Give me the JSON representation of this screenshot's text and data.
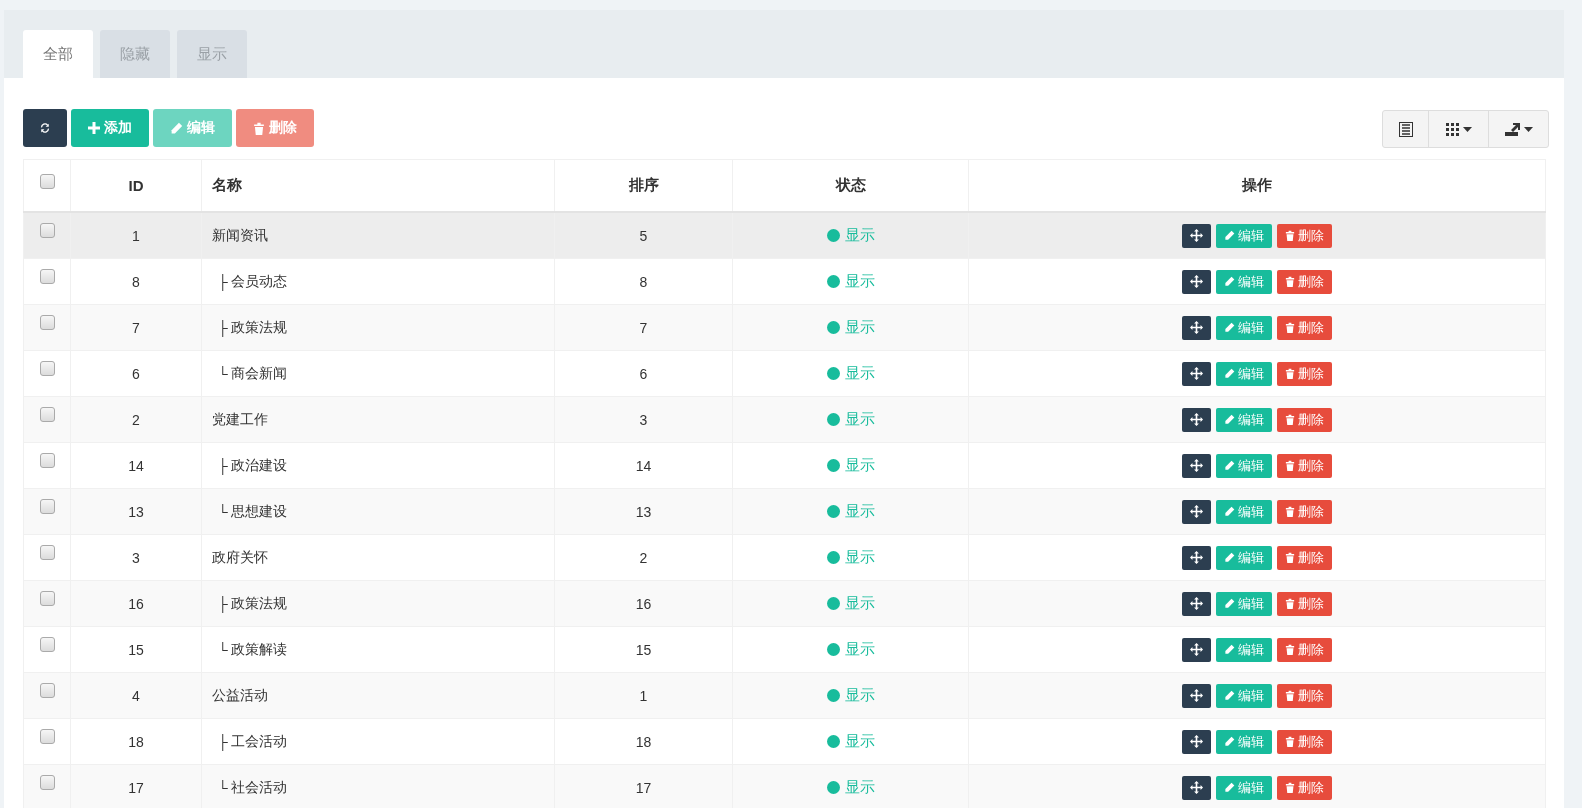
{
  "tabs": [
    {
      "label": "全部",
      "selected": true
    },
    {
      "label": "隐藏",
      "selected": false
    },
    {
      "label": "显示",
      "selected": false
    }
  ],
  "toolbar": {
    "add": "添加",
    "edit": "编辑",
    "delete": "删除",
    "edit_disabled": true,
    "delete_disabled": true
  },
  "table": {
    "columns": [
      "ID",
      "名称",
      "排序",
      "状态",
      "操作"
    ],
    "select_all_checked": false,
    "rows": [
      {
        "id": "1",
        "name": "新闻资讯",
        "sort": "5",
        "status": "显示",
        "checked": false,
        "hovered": true,
        "actions": {
          "edit": "编辑",
          "delete": "删除"
        },
        "children": [
          {
            "branch": "├",
            "id": "8",
            "name": "会员动态",
            "sort": "8",
            "status": "显示",
            "checked": false,
            "hovered": false,
            "actions": {
              "edit": "编辑",
              "delete": "删除"
            }
          },
          {
            "branch": "├",
            "id": "7",
            "name": "政策法规",
            "sort": "7",
            "status": "显示",
            "checked": false,
            "hovered": false,
            "actions": {
              "edit": "编辑",
              "delete": "删除"
            }
          },
          {
            "branch": "└",
            "id": "6",
            "name": "商会新闻",
            "sort": "6",
            "status": "显示",
            "checked": false,
            "hovered": false,
            "actions": {
              "edit": "编辑",
              "delete": "删除"
            }
          }
        ]
      },
      {
        "id": "2",
        "name": "党建工作",
        "sort": "3",
        "status": "显示",
        "checked": false,
        "hovered": false,
        "actions": {
          "edit": "编辑",
          "delete": "删除"
        },
        "children": [
          {
            "branch": "├",
            "id": "14",
            "name": "政治建设",
            "sort": "14",
            "status": "显示",
            "checked": false,
            "hovered": false,
            "actions": {
              "edit": "编辑",
              "delete": "删除"
            }
          },
          {
            "branch": "└",
            "id": "13",
            "name": "思想建设",
            "sort": "13",
            "status": "显示",
            "checked": false,
            "hovered": false,
            "actions": {
              "edit": "编辑",
              "delete": "删除"
            }
          }
        ]
      },
      {
        "id": "3",
        "name": "政府关怀",
        "sort": "2",
        "status": "显示",
        "checked": false,
        "hovered": false,
        "actions": {
          "edit": "编辑",
          "delete": "删除"
        },
        "children": [
          {
            "branch": "├",
            "id": "16",
            "name": "政策法规",
            "sort": "16",
            "status": "显示",
            "checked": false,
            "hovered": false,
            "actions": {
              "edit": "编辑",
              "delete": "删除"
            }
          },
          {
            "branch": "└",
            "id": "15",
            "name": "政策解读",
            "sort": "15",
            "status": "显示",
            "checked": false,
            "hovered": false,
            "actions": {
              "edit": "编辑",
              "delete": "删除"
            }
          }
        ]
      },
      {
        "id": "4",
        "name": "公益活动",
        "sort": "1",
        "status": "显示",
        "checked": false,
        "hovered": false,
        "actions": {
          "edit": "编辑",
          "delete": "删除"
        },
        "children": [
          {
            "branch": "├",
            "id": "18",
            "name": "工会活动",
            "sort": "18",
            "status": "显示",
            "checked": false,
            "hovered": false,
            "actions": {
              "edit": "编辑",
              "delete": "删除"
            }
          },
          {
            "branch": "└",
            "id": "17",
            "name": "社会活动",
            "sort": "17",
            "status": "显示",
            "checked": false,
            "hovered": false,
            "actions": {
              "edit": "编辑",
              "delete": "删除"
            }
          }
        ]
      }
    ]
  }
}
